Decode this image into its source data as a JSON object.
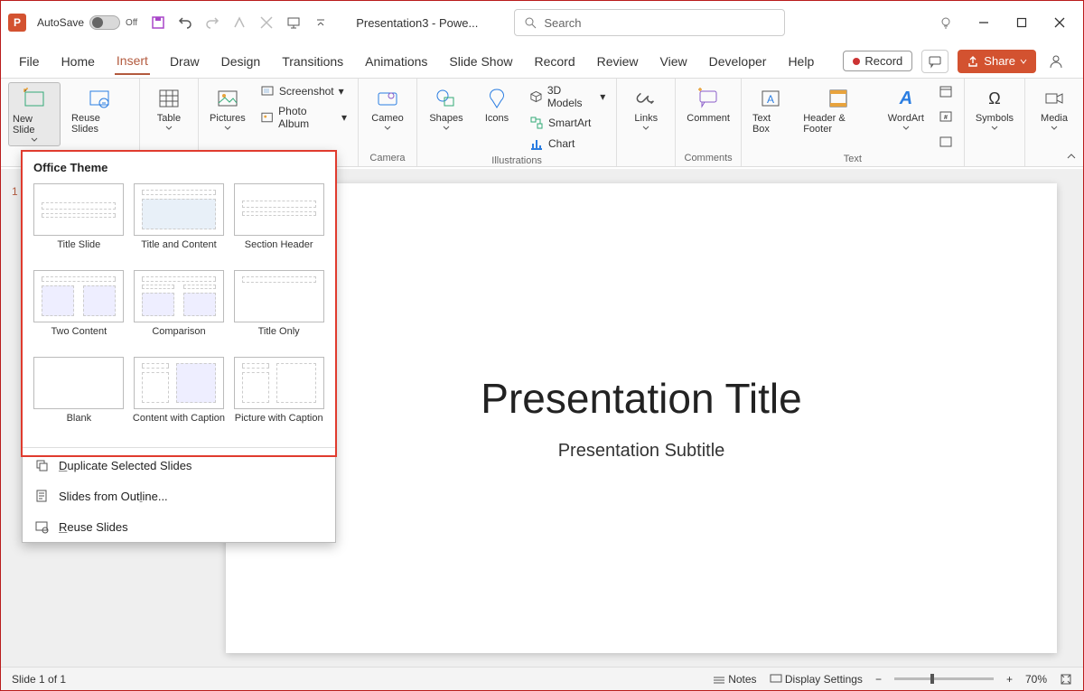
{
  "titlebar": {
    "autosave_label": "AutoSave",
    "autosave_state": "Off",
    "doc_title": "Presentation3 - Powe...",
    "search_placeholder": "Search"
  },
  "tabs": {
    "items": [
      "File",
      "Home",
      "Insert",
      "Draw",
      "Design",
      "Transitions",
      "Animations",
      "Slide Show",
      "Record",
      "Review",
      "View",
      "Developer",
      "Help"
    ],
    "active": "Insert",
    "record_label": "Record",
    "share_label": "Share"
  },
  "ribbon": {
    "new_slide": "New Slide",
    "reuse_slides": "Reuse Slides",
    "table": "Table",
    "pictures": "Pictures",
    "screenshot": "Screenshot",
    "photo_album": "Photo Album",
    "cameo": "Cameo",
    "shapes": "Shapes",
    "icons": "Icons",
    "models": "3D Models",
    "smartart": "SmartArt",
    "chart": "Chart",
    "links": "Links",
    "comment": "Comment",
    "textbox": "Text Box",
    "header_footer": "Header & Footer",
    "wordart": "WordArt",
    "symbols": "Symbols",
    "media": "Media",
    "group_camera": "Camera",
    "group_illustrations": "Illustrations",
    "group_comments": "Comments",
    "group_text": "Text"
  },
  "dropdown": {
    "header": "Office Theme",
    "layouts": [
      "Title Slide",
      "Title and Content",
      "Section Header",
      "Two Content",
      "Comparison",
      "Title Only",
      "Blank",
      "Content with Caption",
      "Picture with Caption"
    ],
    "duplicate": "Duplicate Selected Slides",
    "outline": "Slides from Outline...",
    "reuse": "Reuse Slides"
  },
  "slide": {
    "title": "Presentation Title",
    "subtitle": "Presentation Subtitle",
    "thumb_num": "1"
  },
  "status": {
    "slide_counter": "Slide 1 of 1",
    "notes": "Notes",
    "display": "Display Settings",
    "zoom": "70%"
  }
}
